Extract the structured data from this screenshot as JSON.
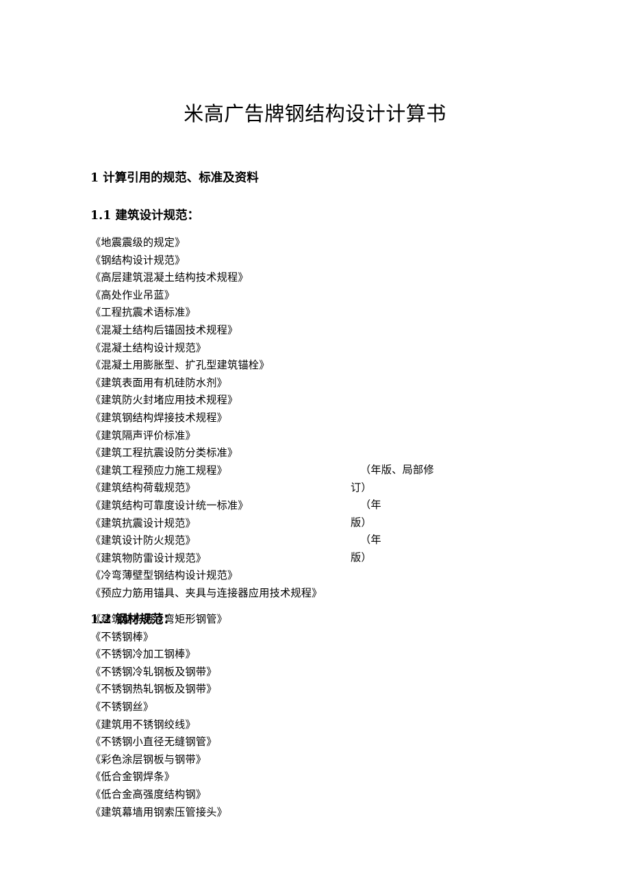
{
  "document": {
    "title": "米高广告牌钢结构设计计算书"
  },
  "sections": {
    "section1": {
      "heading": "1 计算引用的规范、标准及资料",
      "subsection11": {
        "heading": "1.1 建筑设计规范：",
        "standards": [
          "《地震震级的规定》",
          "《钢结构设计规范》",
          "《高层建筑混凝土结构技术规程》",
          "《高处作业吊蓝》",
          "《工程抗震术语标准》",
          "《混凝土结构后锚固技术规程》",
          "《混凝土结构设计规范》",
          "《混凝土用膨胀型、扩孔型建筑锚栓》",
          "《建筑表面用有机硅防水剂》",
          "《建筑防火封堵应用技术规程》",
          "《建筑钢结构焊接技术规程》",
          "《建筑隔声评价标准》",
          "《建筑工程抗震设防分类标准》",
          "《建筑工程预应力施工规程》",
          "《建筑结构荷载规范》",
          "《建筑结构可靠度设计统一标准》",
          "《建筑抗震设计规范》",
          "《建筑设计防火规范》",
          "《建筑物防雷设计规范》",
          "《冷弯薄壁型钢结构设计规范》",
          "《预应力筋用锚具、夹具与连接器应用技术规程》"
        ],
        "annotations": [
          {
            "line1": "（年版、局部修",
            "line2": "订）"
          },
          {
            "line1": "（年",
            "line2": "版）"
          },
          {
            "line1": "（年",
            "line2": "版）"
          }
        ]
      },
      "subsection12": {
        "heading": "1.2 钢材规范：",
        "standards": [
          "《建筑结构用冷弯矩形钢管》",
          "《不锈钢棒》",
          "《不锈钢冷加工钢棒》",
          "《不锈钢冷轧钢板及钢带》",
          "《不锈钢热轧钢板及钢带》",
          "《不锈钢丝》",
          "《建筑用不锈钢绞线》",
          "《不锈钢小直径无缝钢管》",
          "《彩色涂层钢板与钢带》",
          "《低合金钢焊条》",
          "《低合金高强度结构钢》",
          "《建筑幕墙用钢索压管接头》"
        ]
      }
    }
  }
}
